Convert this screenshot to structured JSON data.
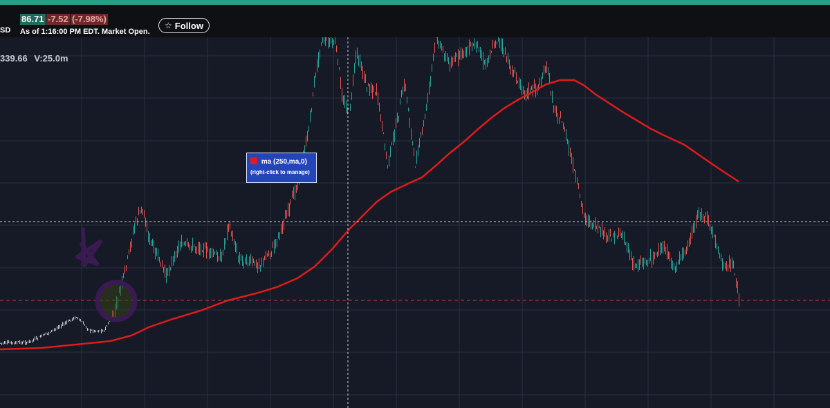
{
  "header": {
    "symbol_fragment": "SD",
    "price": "86.71",
    "change": "-7.52",
    "change_pct": "(-7.98%)",
    "as_of": "As of 1:16:00 PM EDT. Market Open.",
    "follow_label": "Follow",
    "follow_icon": "star-outline-icon"
  },
  "readout": {
    "price": "339.66",
    "volume": "V:25.0m"
  },
  "tooltip": {
    "title": "ma (250,ma,0)",
    "hint": "(right-click to manage)"
  },
  "colors": {
    "accent": "#26a085",
    "price_badge": "#1f6b5c",
    "negative_badge": "#6b2a2a",
    "ma_line": "#e01b1b",
    "candle_up": "#26a69a",
    "candle_down": "#ef5350",
    "tooltip_bg": "#2445b8",
    "annotation": "#3a1a52"
  }
}
